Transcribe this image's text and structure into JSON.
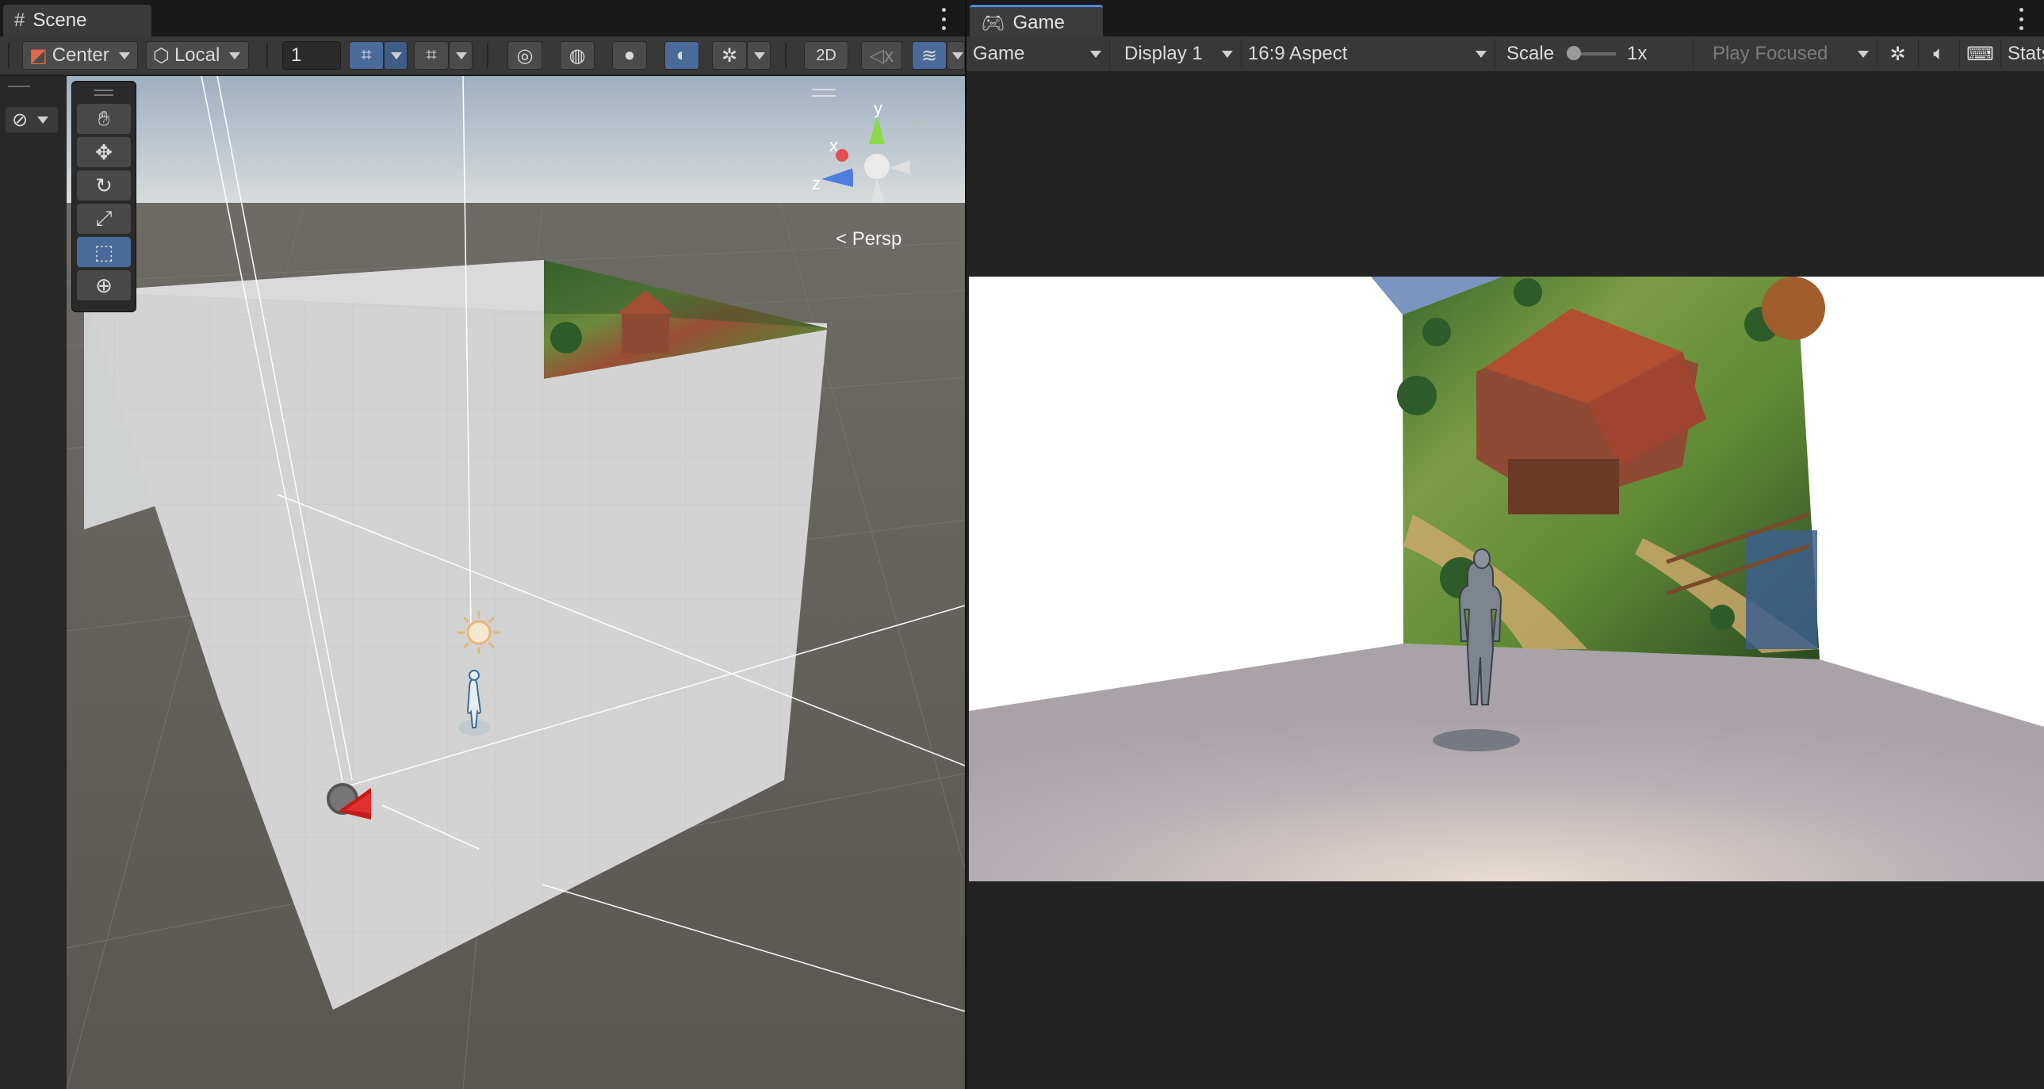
{
  "scene": {
    "tab_label": "Scene",
    "toolbar": {
      "pivot_label": "Center",
      "space_label": "Local",
      "grid_size_value": "1",
      "mode_2d_label": "2D"
    },
    "view_mode_label": "Persp",
    "gizmo_axes": {
      "x": "x",
      "y": "y",
      "z": "z"
    },
    "tools": [
      "hand-tool",
      "move-tool",
      "rotate-tool",
      "scale-tool",
      "rect-tool",
      "transform-tool"
    ],
    "selected_tool": "rect-tool"
  },
  "game": {
    "tab_label": "Game",
    "toolbar": {
      "mode_label": "Game",
      "display_label": "Display 1",
      "aspect_label": "16:9 Aspect",
      "scale_label": "Scale",
      "scale_value": "1x",
      "scale_level": 0.0,
      "play_focus_label": "Play Focused",
      "stats_label": "Stats"
    }
  },
  "colors": {
    "accent": "#4a6a99",
    "tab_underline": "#4a89dc",
    "panel_bg": "#191919",
    "toolbar_bg": "#383838"
  }
}
